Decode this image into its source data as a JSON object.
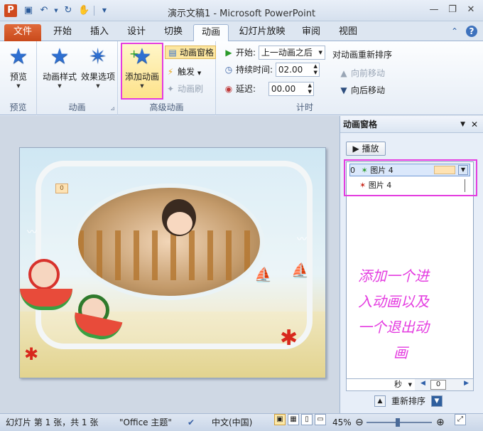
{
  "window": {
    "title": "演示文稿1 - Microsoft PowerPoint",
    "app_icon": "P"
  },
  "tabs": [
    {
      "label": "文件",
      "kind": "file"
    },
    {
      "label": "开始"
    },
    {
      "label": "插入"
    },
    {
      "label": "设计"
    },
    {
      "label": "切换"
    },
    {
      "label": "动画",
      "active": true
    },
    {
      "label": "幻灯片放映"
    },
    {
      "label": "审阅"
    },
    {
      "label": "视图"
    }
  ],
  "ribbon": {
    "preview_group": {
      "label": "预览",
      "button": "预览"
    },
    "animation_group": {
      "label": "动画",
      "style_btn": "动画样式",
      "effect_btn": "效果选项"
    },
    "advanced_group": {
      "label": "高级动画",
      "add_btn": "添加动画",
      "pane_btn": "动画窗格",
      "trigger_btn": "触发",
      "brush_btn": "动画刷"
    },
    "timing_group": {
      "label": "计时",
      "start_label": "开始:",
      "start_value": "上一动画之后",
      "duration_label": "持续时间:",
      "duration_value": "02.00",
      "delay_label": "延迟:",
      "delay_value": "00.00",
      "reorder_label": "对动画重新排序",
      "forward_label": "向前移动",
      "backward_label": "向后移动"
    }
  },
  "slide": {
    "tag_number": "0"
  },
  "pane": {
    "title": "动画窗格",
    "play_label": "播放",
    "items": [
      {
        "num": "0",
        "name": "图片 4"
      },
      {
        "num": "",
        "name": "图片 4"
      }
    ],
    "annotation": [
      "添加一个进",
      "入动画以及",
      "一个退出动",
      "画"
    ],
    "timeline_unit": "秒",
    "timeline_zero": "0",
    "reorder_label": "重新排序"
  },
  "status": {
    "slide_info": "幻灯片 第 1 张，共 1 张",
    "theme": "\"Office 主题\"",
    "language": "中文(中国)",
    "zoom": "45%"
  },
  "colors": {
    "accent": "#e43ce0",
    "file_tab": "#c94a1b",
    "star": "#2e6fd1"
  }
}
